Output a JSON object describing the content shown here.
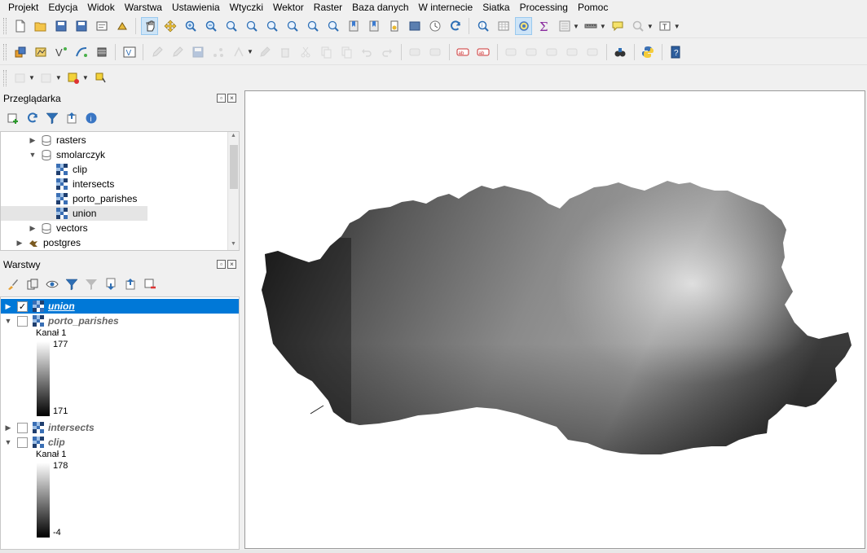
{
  "menu": [
    "Projekt",
    "Edycja",
    "Widok",
    "Warstwa",
    "Ustawienia",
    "Wtyczki",
    "Wektor",
    "Raster",
    "Baza danych",
    "W internecie",
    "Siatka",
    "Processing",
    "Pomoc"
  ],
  "toolbar1": [
    {
      "name": "new-project-icon",
      "active": false
    },
    {
      "name": "open-project-icon",
      "active": false
    },
    {
      "name": "save-project-icon",
      "active": false
    },
    {
      "name": "save-as-icon",
      "active": false
    },
    {
      "name": "print-composer-icon",
      "active": false
    },
    {
      "name": "style-manager-icon",
      "active": false
    },
    {
      "name": "sep"
    },
    {
      "name": "pan-icon",
      "active": true
    },
    {
      "name": "pan-to-selection-icon",
      "active": false
    },
    {
      "name": "zoom-in-icon",
      "active": false
    },
    {
      "name": "zoom-out-icon",
      "active": false
    },
    {
      "name": "zoom-full-icon",
      "active": false
    },
    {
      "name": "zoom-selection-icon",
      "active": false
    },
    {
      "name": "zoom-layer-icon",
      "active": false
    },
    {
      "name": "zoom-native-icon",
      "active": false
    },
    {
      "name": "zoom-last-icon",
      "active": false
    },
    {
      "name": "zoom-next-icon",
      "active": false
    },
    {
      "name": "new-bookmark-icon",
      "active": false
    },
    {
      "name": "show-bookmarks-icon",
      "active": false
    },
    {
      "name": "temporal-icon",
      "active": false
    },
    {
      "name": "map-tips-icon",
      "active": false
    },
    {
      "name": "clock-icon",
      "active": false
    },
    {
      "name": "refresh-icon",
      "active": false
    },
    {
      "name": "sep"
    },
    {
      "name": "identify-icon",
      "active": false
    },
    {
      "name": "attribute-table-icon",
      "active": false
    },
    {
      "name": "select-features-icon",
      "active": true
    },
    {
      "name": "statistics-sigma-icon",
      "active": false
    },
    {
      "name": "open-field-calculator-icon",
      "active": false,
      "dd": true
    },
    {
      "name": "measure-line-icon",
      "active": false,
      "dd": true
    },
    {
      "name": "annotation-icon",
      "active": false
    },
    {
      "name": "select-by-location-icon",
      "active": false,
      "dd": true
    },
    {
      "name": "text-annotation-icon",
      "active": false,
      "dd": true
    }
  ],
  "toolbar2": [
    {
      "name": "data-source-manager-icon"
    },
    {
      "name": "add-vector-icon"
    },
    {
      "name": "digitize-v-icon"
    },
    {
      "name": "add-raster-icon"
    },
    {
      "name": "add-database-icon"
    },
    {
      "name": "sep"
    },
    {
      "name": "edit-v-icon"
    },
    {
      "name": "sep"
    },
    {
      "name": "toggle-editing-icon",
      "dim": true
    },
    {
      "name": "edit-pencil-icon",
      "dim": true
    },
    {
      "name": "save-edits-icon",
      "dim": true
    },
    {
      "name": "add-point-icon",
      "dim": true
    },
    {
      "name": "vertex-tool-icon",
      "dim": true,
      "dd": true
    },
    {
      "name": "edit-attributes-icon",
      "dim": true
    },
    {
      "name": "delete-selected-icon",
      "dim": true
    },
    {
      "name": "cut-features-icon",
      "dim": true
    },
    {
      "name": "copy-features-icon",
      "dim": true
    },
    {
      "name": "paste-features-icon",
      "dim": true
    },
    {
      "name": "undo-icon",
      "dim": true
    },
    {
      "name": "redo-icon",
      "dim": true
    },
    {
      "name": "sep"
    },
    {
      "name": "label-tool-icon",
      "dim": true
    },
    {
      "name": "label-pin-icon",
      "dim": true
    },
    {
      "name": "sep"
    },
    {
      "name": "label-ab-icon"
    },
    {
      "name": "label-abc-icon"
    },
    {
      "name": "sep"
    },
    {
      "name": "rotate-label-icon",
      "dim": true
    },
    {
      "name": "show-label-icon",
      "dim": true
    },
    {
      "name": "change-label-icon",
      "dim": true
    },
    {
      "name": "move-label-icon",
      "dim": true
    },
    {
      "name": "highlight-label-icon",
      "dim": true
    },
    {
      "name": "sep"
    },
    {
      "name": "plugin-binoculars-icon"
    },
    {
      "name": "sep"
    },
    {
      "name": "python-icon"
    },
    {
      "name": "sep"
    },
    {
      "name": "help-icon"
    }
  ],
  "toolbar3": [
    {
      "name": "digitize-polygon-icon",
      "dim": true,
      "dd": true
    },
    {
      "name": "digitize-shape-icon",
      "dim": true,
      "dd": true
    },
    {
      "name": "selection-filter-icon",
      "dd": true
    },
    {
      "name": "map-pin-icon"
    }
  ],
  "browser_panel": {
    "title": "Przeglądarka",
    "tools": [
      "add-selected-icon",
      "refresh-icon",
      "filter-icon",
      "collapse-all-icon",
      "info-icon"
    ],
    "items": [
      {
        "label": "rasters",
        "level": 1,
        "expanded": false,
        "type": "db",
        "selected": false
      },
      {
        "label": "smolarczyk",
        "level": 1,
        "expanded": true,
        "type": "db",
        "selected": false
      },
      {
        "label": "clip",
        "level": 2,
        "type": "raster",
        "selected": false
      },
      {
        "label": "intersects",
        "level": 2,
        "type": "raster",
        "selected": false
      },
      {
        "label": "porto_parishes",
        "level": 2,
        "type": "raster",
        "selected": false
      },
      {
        "label": "union",
        "level": 2,
        "type": "raster",
        "selected": true
      },
      {
        "label": "vectors",
        "level": 1,
        "expanded": false,
        "type": "db",
        "selected": false
      },
      {
        "label": "postgres",
        "level": 0,
        "expanded": false,
        "type": "postgres",
        "selected": false
      }
    ]
  },
  "layers_panel": {
    "title": "Warstwy",
    "tools": [
      "style-brush-icon",
      "add-group-icon",
      "visibility-eye-icon",
      "filter-legend-icon",
      "filter-expression-icon",
      "expand-all-icon",
      "collapse-all-icon",
      "remove-layer-icon"
    ],
    "layers": [
      {
        "name": "union",
        "checked": true,
        "expanded": false,
        "selected": true
      },
      {
        "name": "porto_parishes",
        "checked": false,
        "expanded": true,
        "selected": false,
        "band": "Kanał 1",
        "max": "177",
        "min": "171"
      },
      {
        "name": "intersects",
        "checked": false,
        "expanded": false,
        "selected": false
      },
      {
        "name": "clip",
        "checked": false,
        "expanded": true,
        "selected": false,
        "band": "Kanał 1",
        "max": "178",
        "min": "-4"
      }
    ]
  },
  "colors": {
    "selection": "#0078d7",
    "active_tool": "#cde4f7"
  }
}
